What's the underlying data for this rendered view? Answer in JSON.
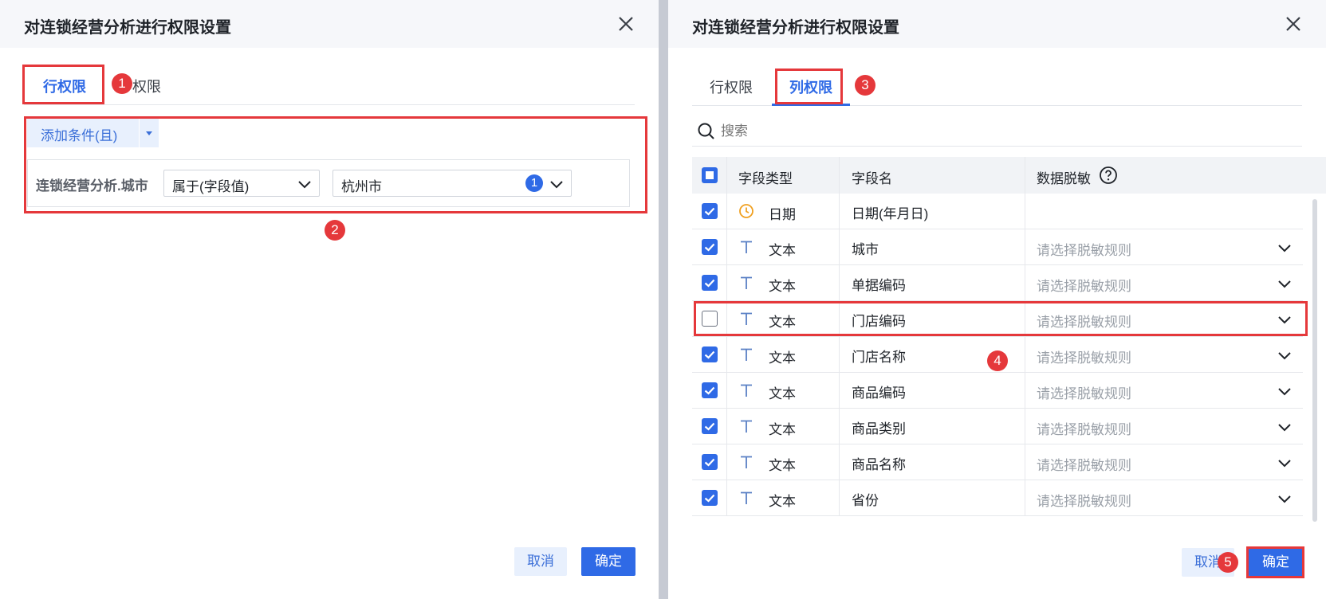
{
  "left_dialog": {
    "title": "对连锁经营分析进行权限设置",
    "tabs": {
      "row": "行权限",
      "col_partial": "权限"
    },
    "add_condition_label": "添加条件(且)",
    "condition": {
      "field": "连锁经营分析.城市",
      "operator": "属于(字段值)",
      "value": "杭州市",
      "value_count": "1"
    },
    "cancel_label": "取消",
    "ok_label": "确定"
  },
  "right_dialog": {
    "title": "对连锁经营分析进行权限设置",
    "tabs": {
      "row": "行权限",
      "col": "列权限"
    },
    "search_placeholder": "搜索",
    "table": {
      "headers": [
        "字段类型",
        "字段名",
        "数据脱敏"
      ],
      "mask_placeholder": "请选择脱敏规则",
      "rows": [
        {
          "type": "日期",
          "name": "日期(年月日)",
          "checked": true,
          "icon": "clock-icon"
        },
        {
          "type": "文本",
          "name": "城市",
          "checked": true,
          "icon": "text-type-icon"
        },
        {
          "type": "文本",
          "name": "单据编码",
          "checked": true,
          "icon": "text-type-icon"
        },
        {
          "type": "文本",
          "name": "门店编码",
          "checked": false,
          "icon": "text-type-icon"
        },
        {
          "type": "文本",
          "name": "门店名称",
          "checked": true,
          "icon": "text-type-icon"
        },
        {
          "type": "文本",
          "name": "商品编码",
          "checked": true,
          "icon": "text-type-icon"
        },
        {
          "type": "文本",
          "name": "商品类别",
          "checked": true,
          "icon": "text-type-icon"
        },
        {
          "type": "文本",
          "name": "商品名称",
          "checked": true,
          "icon": "text-type-icon"
        },
        {
          "type": "文本",
          "name": "省份",
          "checked": true,
          "icon": "text-type-icon"
        }
      ]
    },
    "cancel_label": "取消",
    "ok_label": "确定"
  },
  "annotations": [
    "1",
    "2",
    "3",
    "4",
    "5"
  ],
  "colors": {
    "accent": "#2f6ae6",
    "highlight": "#e5383b",
    "date_icon": "#f0a020"
  }
}
